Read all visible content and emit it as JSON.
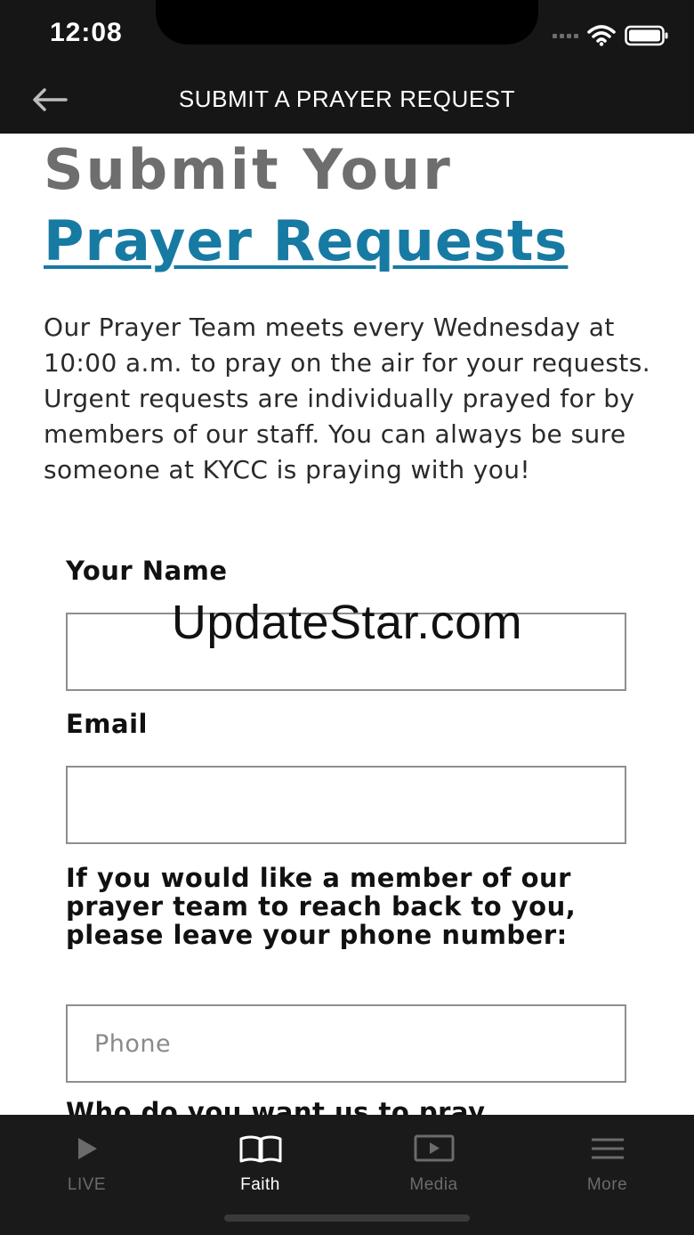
{
  "status_bar": {
    "time": "12:08"
  },
  "header": {
    "title": "SUBMIT A PRAYER REQUEST",
    "back_icon": "back-arrow-icon"
  },
  "page": {
    "heading_line1": "Submit Your",
    "heading_line2": "Prayer Requests",
    "intro": "Our Prayer Team meets every Wednesday at 10:00 a.m. to pray on the air for your requests. Urgent requests are individually prayed for by members of our staff. You can always be sure someone at KYCC is praying with you!"
  },
  "form": {
    "name_label": "Your Name",
    "name_value": "",
    "email_label": "Email",
    "email_value": "",
    "phone_label": "If you would like a member of our prayer team to reach back to you, please leave your phone number:",
    "phone_value": "",
    "phone_placeholder": "Phone",
    "next_label_partial": "Who do you want us to pray"
  },
  "watermark": "UpdateStar.com",
  "tabbar": {
    "tabs": [
      {
        "label": "LIVE",
        "icon": "play-icon",
        "active": false
      },
      {
        "label": "Faith",
        "icon": "book-icon",
        "active": true
      },
      {
        "label": "Media",
        "icon": "video-icon",
        "active": false
      },
      {
        "label": "More",
        "icon": "menu-icon",
        "active": false
      }
    ]
  },
  "colors": {
    "header_bg": "#161616",
    "heading_gray": "#6e6e6e",
    "heading_blue": "#177aa3",
    "tabbar_bg": "#1a1a1a",
    "tab_inactive": "#6b6b6b",
    "tab_active": "#ffffff"
  }
}
